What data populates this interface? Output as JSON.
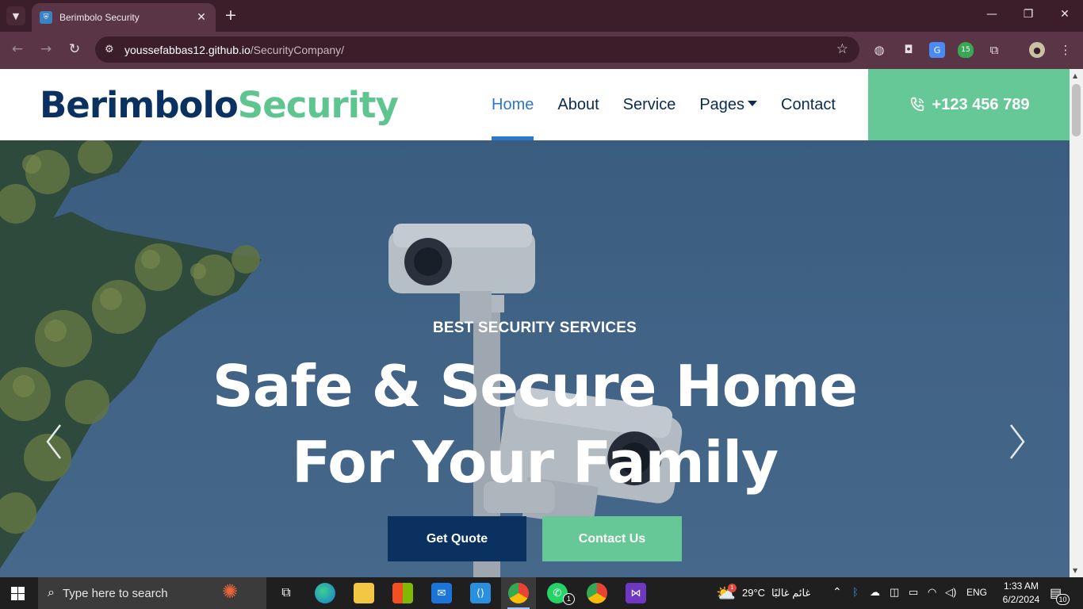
{
  "browser": {
    "tab_title": "Berimbolo Security",
    "url_domain": "youssefabbas12.github.io",
    "url_path": "/SecurityCompany/"
  },
  "site": {
    "logo_part1": "Berimbolo",
    "logo_part2": "Security",
    "nav": [
      "Home",
      "About",
      "Service",
      "Pages",
      "Contact"
    ],
    "active_nav": "Home",
    "phone": "+123 456 789",
    "colors": {
      "navy": "#0b3160",
      "green": "#66c896",
      "active": "#2d78c9"
    }
  },
  "hero": {
    "subtitle": "BEST SECURITY SERVICES",
    "title_line1": "Safe & Secure Home",
    "title_line2": "For Your Family",
    "btn_quote": "Get Quote",
    "btn_contact": "Contact Us"
  },
  "taskbar": {
    "search_placeholder": "Type here to search",
    "weather_temp": "29°C",
    "weather_desc": "غائم غالبًا",
    "language": "ENG",
    "time": "1:33 AM",
    "date": "6/2/2024",
    "whatsapp_badge": "1",
    "notification_count": "10",
    "weather_badge": "1"
  }
}
